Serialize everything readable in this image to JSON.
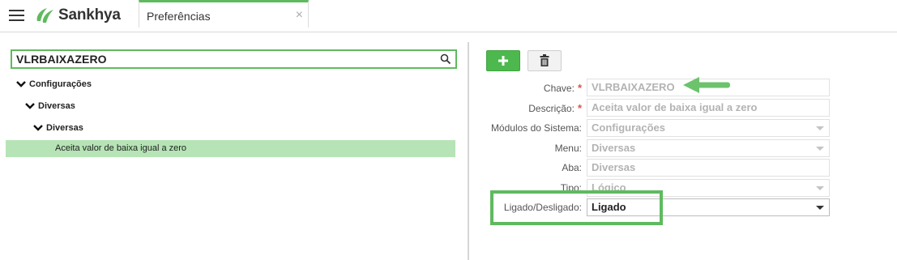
{
  "header": {
    "brand": "Sankhya",
    "tab_label": "Preferências",
    "tab_close": "×"
  },
  "search": {
    "value": "VLRBAIXAZERO"
  },
  "tree": {
    "level1": "Configurações",
    "level2": "Diversas",
    "level3": "Diversas",
    "leaf": "Aceita valor de baixa igual a zero"
  },
  "toolbar": {
    "add_label": "+",
    "delete_icon": "trash-icon"
  },
  "form": {
    "chave_label": "Chave:",
    "chave_value": "VLRBAIXAZERO",
    "descricao_label": "Descrição:",
    "descricao_value": "Aceita valor de baixa igual a zero",
    "modulos_label": "Módulos do Sistema:",
    "modulos_value": "Configurações",
    "menu_label": "Menu:",
    "menu_value": "Diversas",
    "aba_label": "Aba:",
    "aba_value": "Diversas",
    "tipo_label": "Tipo:",
    "tipo_value": "Lógico",
    "ligado_label": "Ligado/Desligado:",
    "ligado_value": "Ligado",
    "required_mark": "*"
  },
  "colors": {
    "accent_green": "#5fba5f",
    "selected_row": "#b6e4b6",
    "required": "#d9534f"
  }
}
